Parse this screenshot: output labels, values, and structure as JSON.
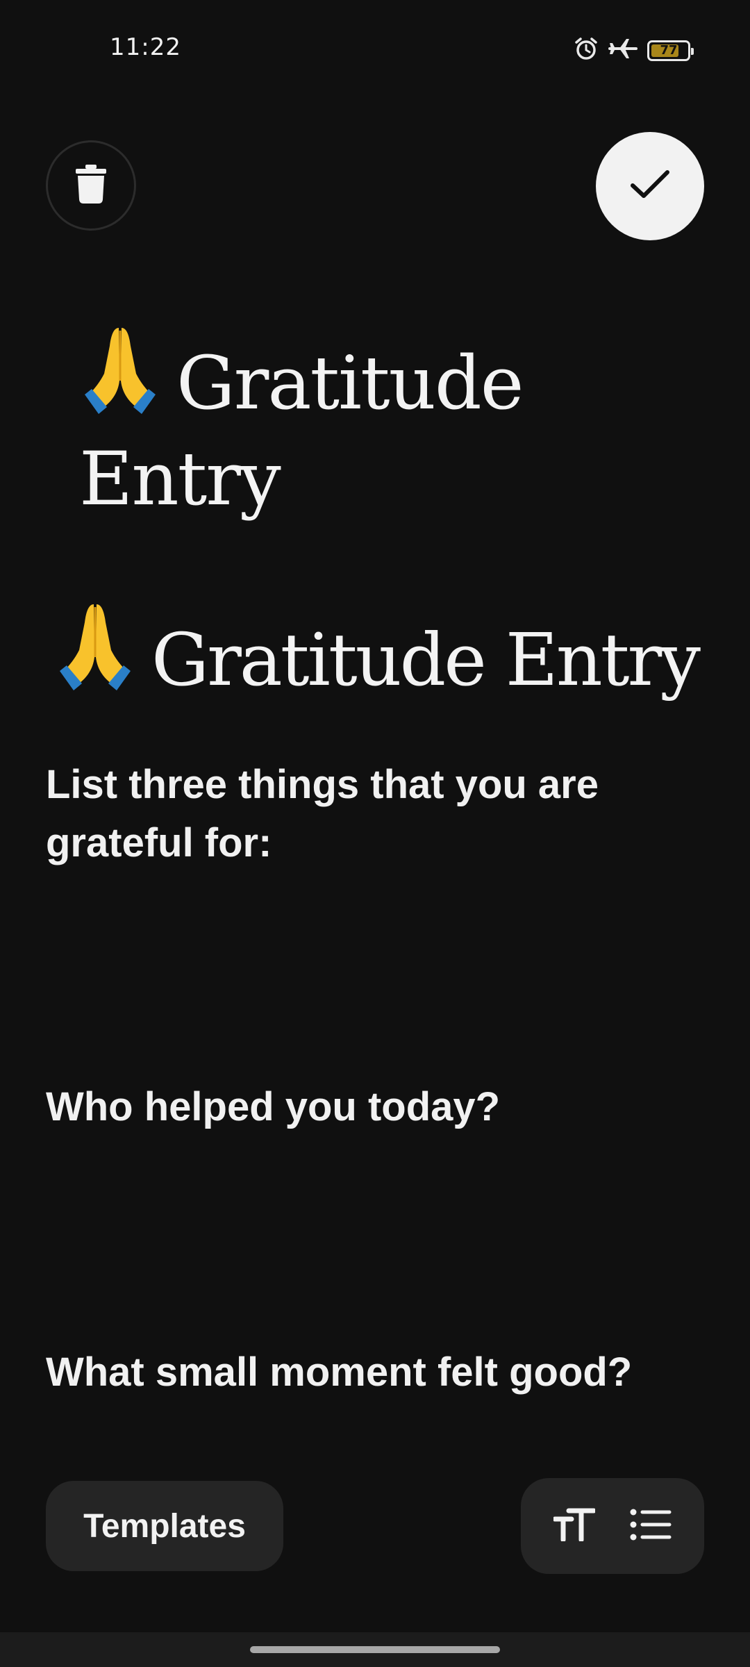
{
  "status_bar": {
    "time": "11:22",
    "icons": [
      "alarm-icon",
      "airplane-mode-icon",
      "battery-icon"
    ],
    "battery_level": "77",
    "battery_fraction": 0.77
  },
  "toolbar": {
    "delete_icon": "trash-icon",
    "done_icon": "checkmark-icon"
  },
  "entry": {
    "title_emoji": "🙏",
    "title_text": "Gratitude Entry",
    "heading_emoji": "🙏",
    "heading_text": "Gratitude Entry",
    "prompts": [
      "List three things that you are grateful for:",
      "Who helped you today?",
      "What small moment felt good?"
    ]
  },
  "bottom_bar": {
    "templates_label": "Templates",
    "text_size_icon": "text-size-icon",
    "list_icon": "bulleted-list-icon"
  },
  "colors": {
    "background": "#101010",
    "text": "#f3f3f3",
    "pill": "#252525",
    "done_button": "#f2f2f2",
    "battery_fill": "#a8861a"
  }
}
